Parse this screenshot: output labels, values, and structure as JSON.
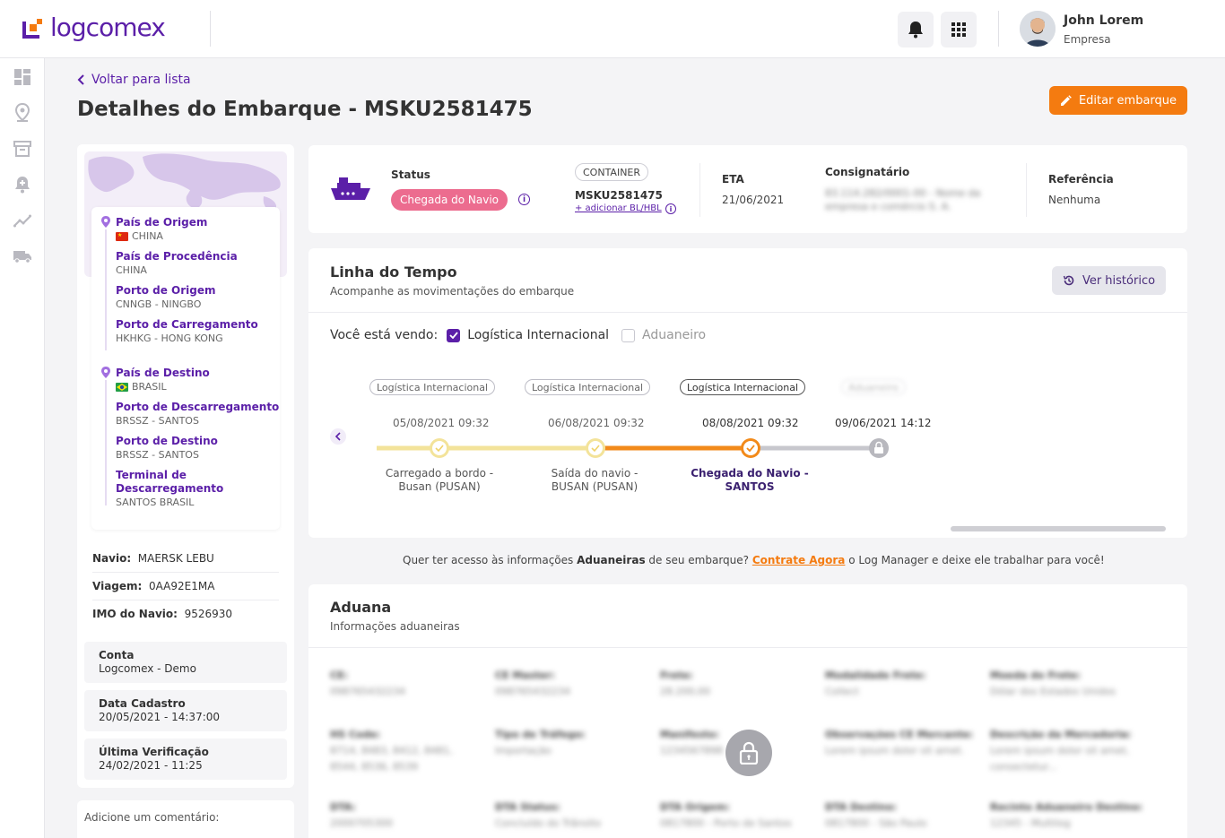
{
  "header": {
    "logo_text": "logcomex",
    "user_name": "John Lorem",
    "user_company": "Empresa"
  },
  "page": {
    "back_label": "Voltar para lista",
    "title": "Detalhes do Embarque - MSKU2581475",
    "edit_label": "Editar embarque"
  },
  "route": {
    "origin_country_label": "País de Origem",
    "origin_country_value": "CHINA",
    "procedence_label": "País de Procedência",
    "procedence_value": "CHINA",
    "origin_port_label": "Porto de Origem",
    "origin_port_value": "CNNGB - NINGBO",
    "loading_port_label": "Porto de Carregamento",
    "loading_port_value": "HKHKG - HONG KONG",
    "dest_country_label": "País de Destino",
    "dest_country_value": "BRASIL",
    "unloading_port_label": "Porto de Descarregamento",
    "unloading_port_value": "BRSSZ - SANTOS",
    "dest_port_label": "Porto de Destino",
    "dest_port_value": "BRSSZ - SANTOS",
    "terminal_label": "Terminal de Descarregamento",
    "terminal_value": "SANTOS BRASIL"
  },
  "ship": {
    "vessel_label": "Navio:",
    "vessel_value": "MAERSK LEBU",
    "voyage_label": "Viagem:",
    "voyage_value": "0AA92E1MA",
    "imo_label": "IMO do Navio:",
    "imo_value": "9526930"
  },
  "account": {
    "conta_label": "Conta",
    "conta_value": "Logcomex - Demo",
    "cadastro_label": "Data Cadastro",
    "cadastro_value": "20/05/2021 - 14:37:00",
    "verif_label": "Última Verificação",
    "verif_value": "24/02/2021 - 11:25",
    "comment_placeholder": "Adicione um comentário:"
  },
  "status": {
    "status_label": "Status",
    "status_value": "Chegada do Navio",
    "container_tag": "CONTAINER",
    "container_value": "MSKU2581475",
    "add_bl_label": "+ adicionar BL/HBL",
    "eta_label": "ETA",
    "eta_value": "21/06/2021",
    "consignee_label": "Consignatário",
    "consignee_value_line1": "83.114.282/0001-00 - Nome da",
    "consignee_value_line2": "empresa e comércio S. A.",
    "ref_label": "Referência",
    "ref_value": "Nenhuma"
  },
  "timeline": {
    "title": "Linha do Tempo",
    "subtitle": "Acompanhe as movimentações do embarque",
    "history_label": "Ver histórico",
    "viewing_label": "Você está vendo:",
    "filter_intl": "Logística Internacional",
    "filter_customs": "Aduaneiro",
    "events": [
      {
        "tag": "Logística Internacional",
        "date": "05/08/2021 09:32",
        "line1": "Carregado a bordo -",
        "line2": "Busan (PUSAN)"
      },
      {
        "tag": "Logística Internacional",
        "date": "06/08/2021 09:32",
        "line1": "Saída do navio -",
        "line2": "BUSAN (PUSAN)"
      },
      {
        "tag": "Logística Internacional",
        "date": "08/08/2021 09:32",
        "line1": "Chegada do Navio -",
        "line2": "SANTOS"
      },
      {
        "tag": "Aduaneiro",
        "date": "09/06/2021 14:12",
        "line1": "",
        "line2": ""
      }
    ]
  },
  "promo": {
    "pre": "Quer ter acesso às informações",
    "bold": "Aduaneiras",
    "mid": "de seu embarque?",
    "link": "Contrate Agora",
    "post": "o Log Manager e deixe ele trabalhar para você!"
  },
  "aduana": {
    "title": "Aduana",
    "subtitle": "Informações aduaneiras",
    "fields": [
      {
        "k": "CE:",
        "v": "098765432234"
      },
      {
        "k": "CE Master:",
        "v": "098765432234"
      },
      {
        "k": "Frete:",
        "v": "28.200,00"
      },
      {
        "k": "Modalidade Frete:",
        "v": "Collect"
      },
      {
        "k": "Moeda do Frete:",
        "v": "Dólar dos Estados Unidos"
      },
      {
        "k": "HS Code:",
        "v": "8714, 8483, 8412, 8481, 8544, 8536, 8539"
      },
      {
        "k": "Tipo de Tráfego:",
        "v": "Importação"
      },
      {
        "k": "Manifesto:",
        "v": "1234567898"
      },
      {
        "k": "Observações CE Mercante:",
        "v": "Lorem ipsum dolor sit amet."
      },
      {
        "k": "Descrição da Mercadoria:",
        "v": "Lorem ipsum dolor sit amet, consectetur..."
      },
      {
        "k": "DTA:",
        "v": "2000705300"
      },
      {
        "k": "DTA Status:",
        "v": "Concluído do Trânsito"
      },
      {
        "k": "DTA Origem:",
        "v": "0817800 - Porto de Santos"
      },
      {
        "k": "DTA Destino:",
        "v": "0817800 - São Paulo"
      },
      {
        "k": "Recinto Aduaneiro Destino:",
        "v": "12345 - Multilog"
      }
    ]
  },
  "colors": {
    "brand_purple": "#5b1fa8",
    "accent_orange": "#f47b10",
    "status_pink": "#ec6c8f",
    "timeline_yellow": "#f1d77a"
  }
}
